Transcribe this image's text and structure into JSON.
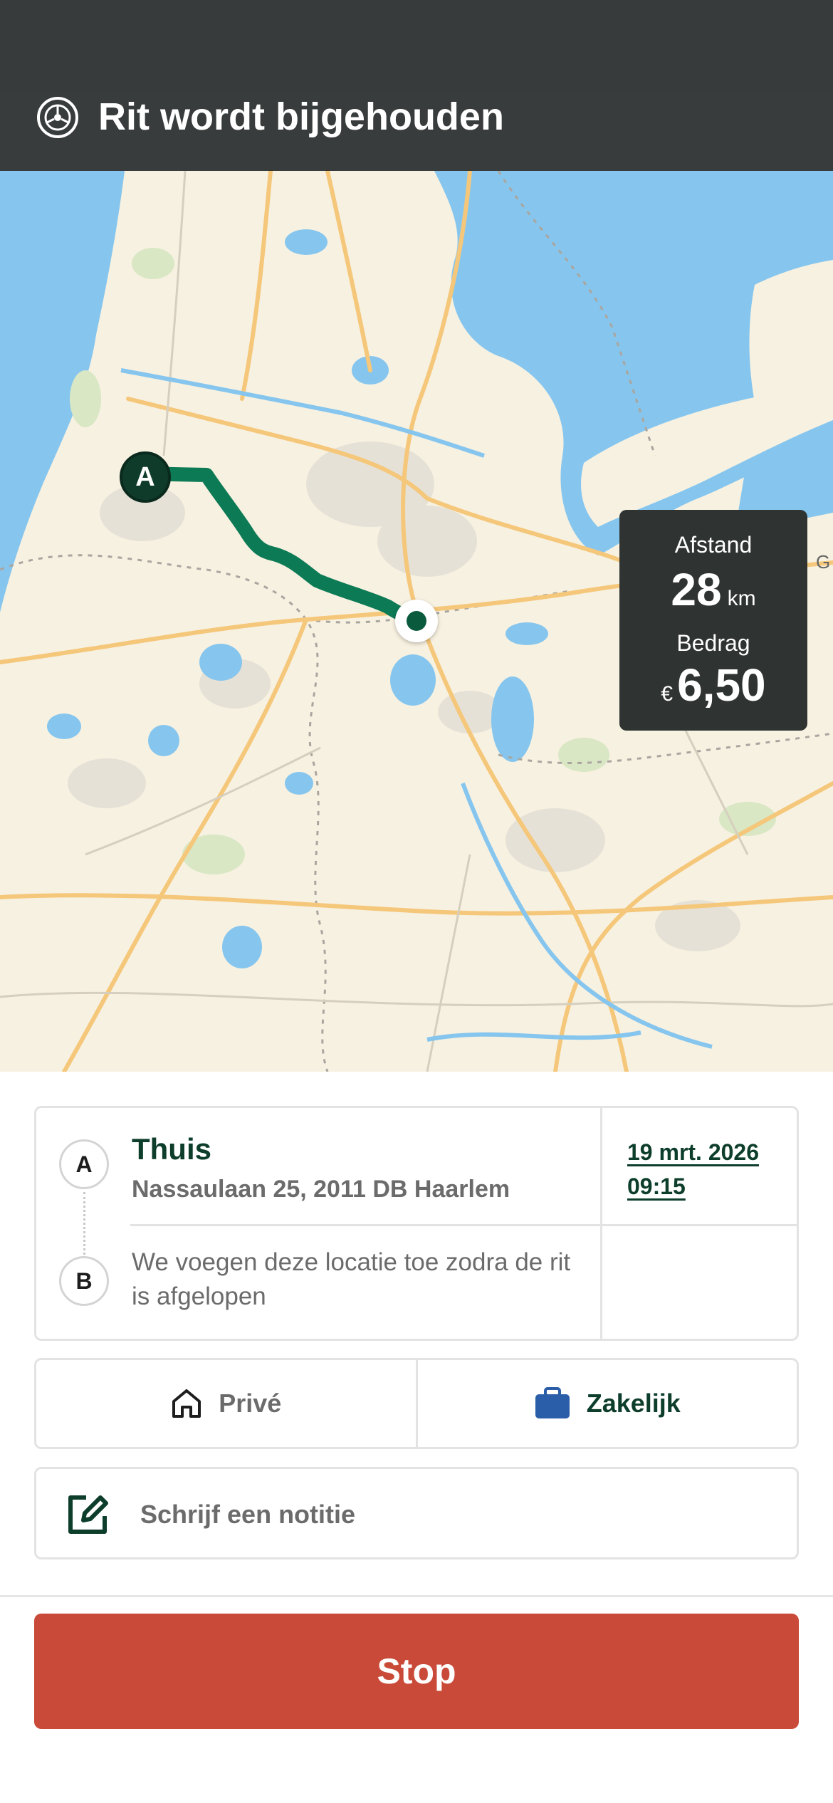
{
  "header": {
    "title": "Rit wordt bijgehouden"
  },
  "map": {
    "start_marker_label": "A",
    "route_color": "#0b7a55",
    "edge_label": "G"
  },
  "stats": {
    "distance_label": "Afstand",
    "distance_value": "28",
    "distance_unit": "km",
    "amount_label": "Bedrag",
    "amount_currency": "€",
    "amount_value": "6,50"
  },
  "trip": {
    "start_letter": "A",
    "end_letter": "B",
    "start_name": "Thuis",
    "start_address": "Nassaulaan 25, 2011 DB Haarlem",
    "start_date": "19 mrt. 2026",
    "start_time": "09:15",
    "end_pending_text": "We voegen deze locatie toe zodra de rit is afgelopen"
  },
  "category": {
    "prive_label": "Privé",
    "prive_icon": "home-icon",
    "zakelijk_label": "Zakelijk",
    "zakelijk_icon": "briefcase-icon",
    "zakelijk_icon_color": "#2a5ea8"
  },
  "note": {
    "placeholder": "Schrijf een notitie",
    "icon": "edit-icon"
  },
  "actions": {
    "stop_label": "Stop",
    "stop_color": "#c94a38"
  }
}
